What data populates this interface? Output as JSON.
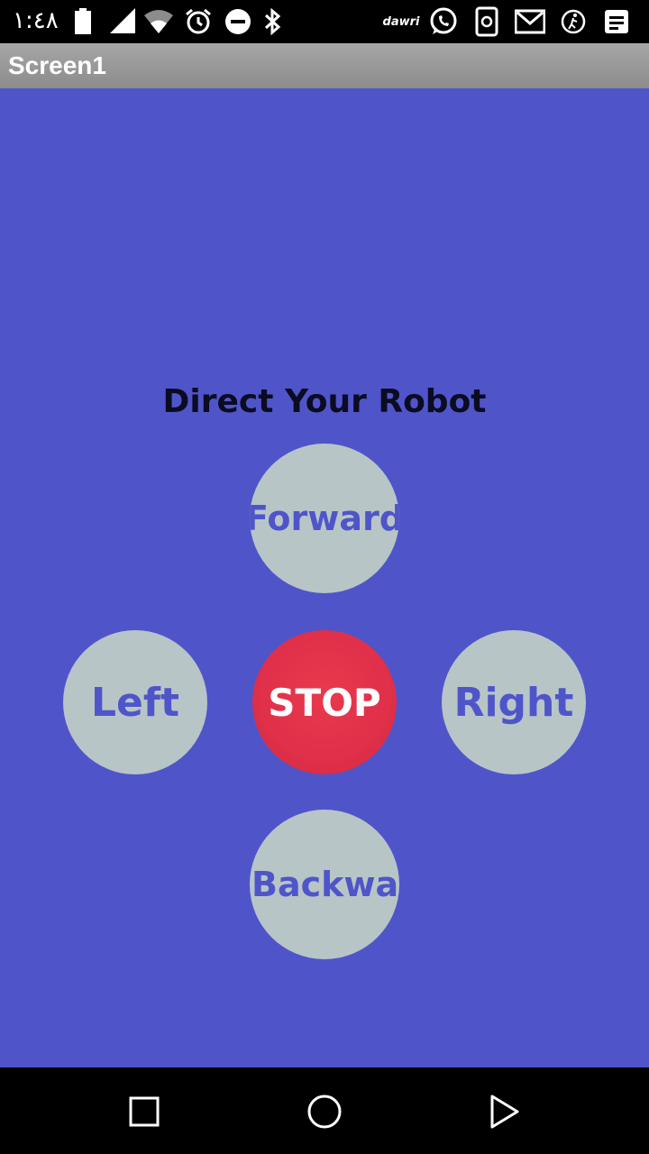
{
  "status_bar": {
    "time": "١:٤٨",
    "icons": [
      "battery-icon",
      "signal-icon",
      "wifi-icon",
      "alarm-icon",
      "do-not-disturb-icon",
      "bluetooth-icon",
      "dawri-app-icon",
      "whatsapp-icon",
      "sync-icon",
      "gmail-icon",
      "fitness-icon",
      "notes-icon"
    ],
    "dawri_label": "dawri"
  },
  "title_bar": {
    "title": "Screen1"
  },
  "main": {
    "heading": "Direct Your Robot",
    "buttons": {
      "forward": "Forward",
      "left": "Left",
      "stop": "STOP",
      "right": "Right",
      "backward": "Backward"
    }
  },
  "nav_bar": {
    "icons": [
      "recents-square-icon",
      "home-circle-icon",
      "back-triangle-icon"
    ]
  },
  "colors": {
    "background": "#4f55c9",
    "button_gray": "#b8c5c7",
    "stop_red": "#e0304a",
    "title_bar": "#9a9a9a"
  }
}
